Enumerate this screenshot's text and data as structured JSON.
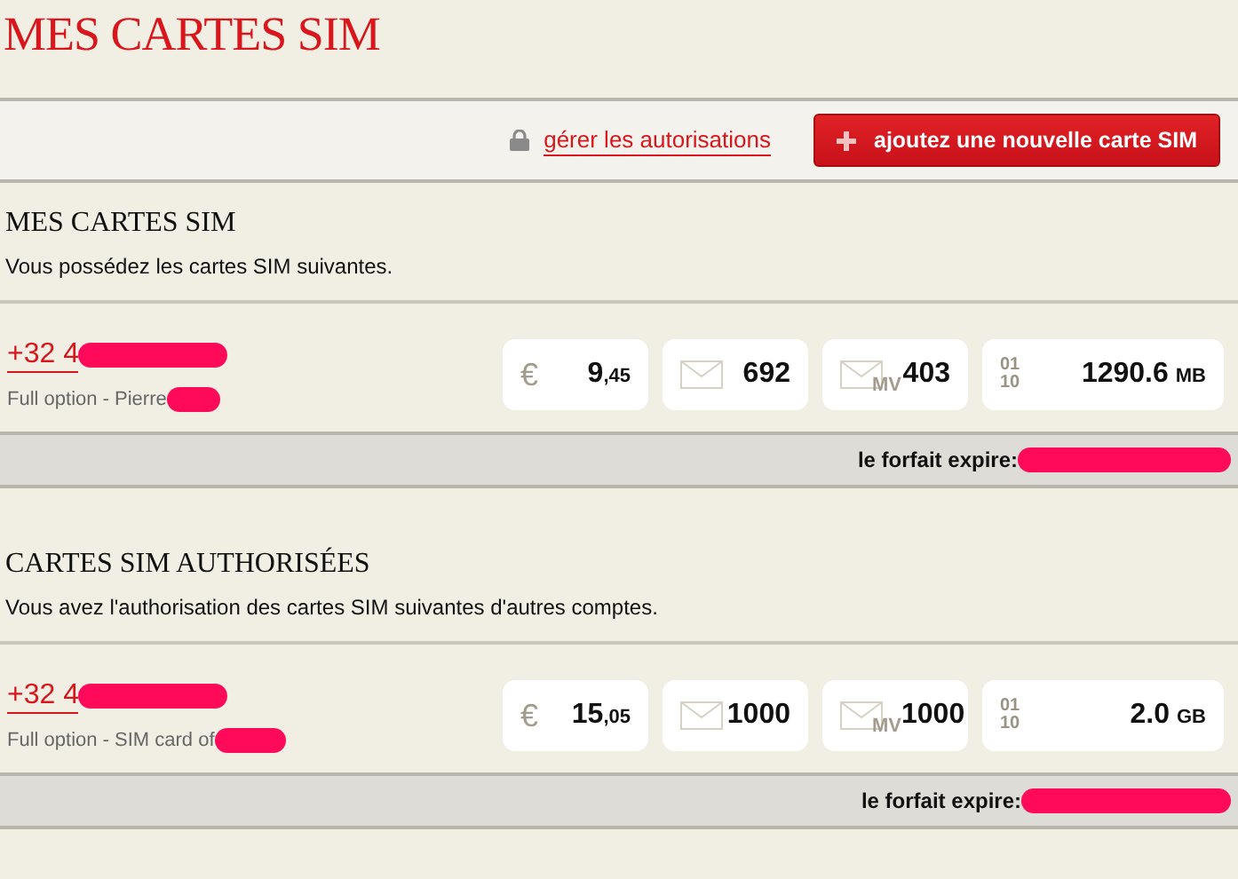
{
  "title": "MES CARTES SIM",
  "toolbar": {
    "link": "gérer les autorisations",
    "button": "ajoutez une nouvelle carte SIM"
  },
  "sections": [
    {
      "heading": "MES CARTES SIM",
      "intro": "Vous possédez les cartes SIM suivantes.",
      "cards": [
        {
          "number": "+32 4",
          "plan": "Full option - Pierre",
          "expiry_label": "le forfait expire:",
          "stats": [
            {
              "kind": "credit",
              "symbol": "€",
              "main": "9",
              "small": ",45"
            },
            {
              "kind": "sms",
              "main": "692"
            },
            {
              "kind": "mms",
              "symbol": "MV",
              "main": "403"
            },
            {
              "kind": "data",
              "symbol": "01 10",
              "main": "1290.6",
              "small": "MB"
            }
          ]
        }
      ]
    },
    {
      "heading": "CARTES SIM AUTHORISÉES",
      "intro": "Vous avez l'authorisation des cartes SIM suivantes d'autres comptes.",
      "cards": [
        {
          "number": "+32 4",
          "plan": "Full option - SIM card of",
          "expiry_label": "le forfait expire:",
          "stats": [
            {
              "kind": "credit",
              "symbol": "€",
              "main": "15",
              "small": ",05"
            },
            {
              "kind": "sms",
              "main": "1000"
            },
            {
              "kind": "mms",
              "symbol": "MV",
              "main": "1000"
            },
            {
              "kind": "data",
              "symbol": "01 10",
              "main": "2.0",
              "small": "GB"
            }
          ]
        }
      ]
    }
  ]
}
